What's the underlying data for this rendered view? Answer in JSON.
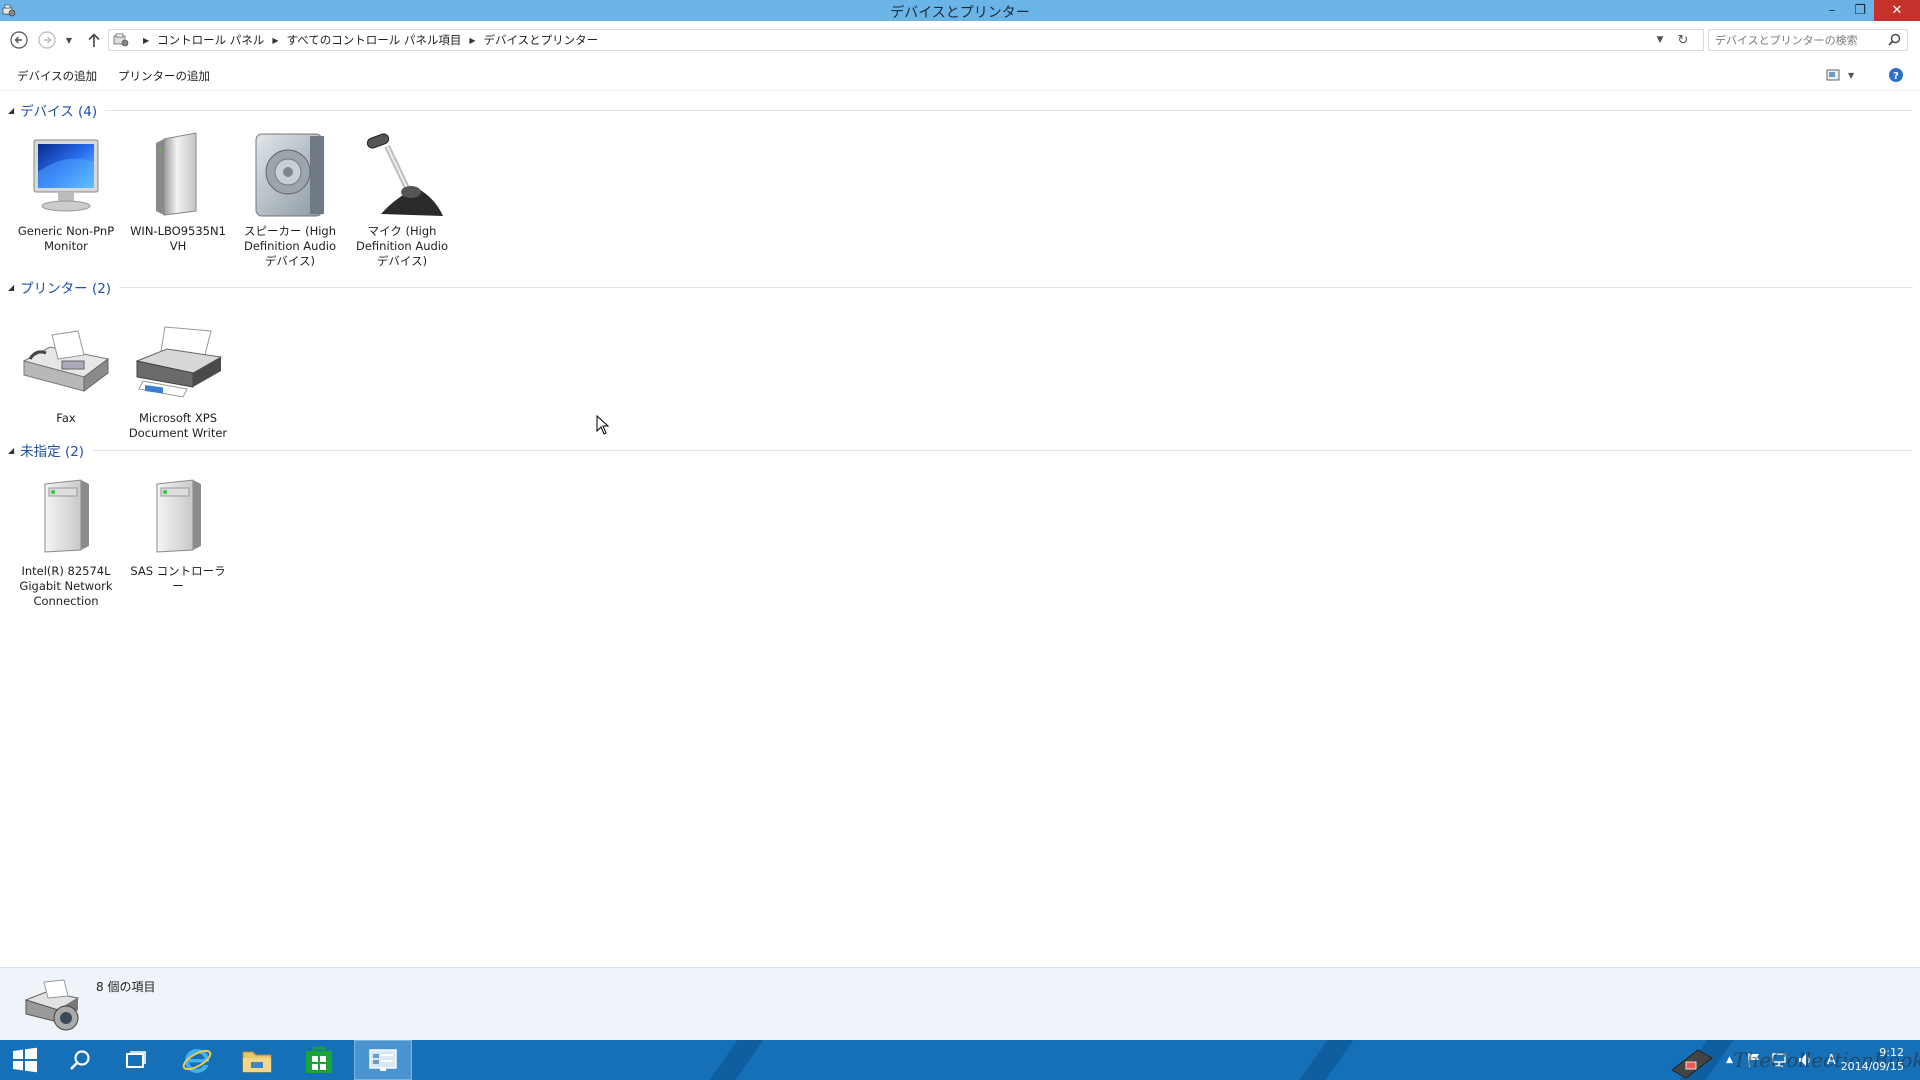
{
  "window": {
    "title": "デバイスとプリンター",
    "minimize": "–",
    "restore": "❐",
    "close": "✕"
  },
  "address": {
    "breadcrumbs": [
      "コントロール パネル",
      "すべてのコントロール パネル項目",
      "デバイスとプリンター"
    ],
    "search_placeholder": "デバイスとプリンターの検索"
  },
  "commands": {
    "add_device": "デバイスの追加",
    "add_printer": "プリンターの追加"
  },
  "groups": {
    "devices": {
      "title": "デバイス (4)",
      "items": [
        {
          "line1": "Generic Non-PnP",
          "line2": "Monitor",
          "line3": "",
          "icon": "monitor-icon"
        },
        {
          "line1": "WIN-LBO9535N1",
          "line2": "VH",
          "line3": "",
          "icon": "computer-tower-icon"
        },
        {
          "line1": "スピーカー (High",
          "line2": "Definition Audio",
          "line3": "デバイス)",
          "icon": "speaker-icon"
        },
        {
          "line1": "マイク (High",
          "line2": "Definition Audio",
          "line3": "デバイス)",
          "icon": "microphone-icon"
        }
      ]
    },
    "printers": {
      "title": "プリンター (2)",
      "items": [
        {
          "line1": "Fax",
          "line2": "",
          "icon": "fax-icon"
        },
        {
          "line1": "Microsoft XPS",
          "line2": "Document Writer",
          "icon": "printer-icon"
        }
      ]
    },
    "unspecified": {
      "title": "未指定 (2)",
      "items": [
        {
          "line1": "Intel(R) 82574L",
          "line2": "Gigabit Network",
          "line3": "Connection",
          "icon": "generic-device-icon"
        },
        {
          "line1": "SAS コントローラー",
          "line2": "",
          "line3": "",
          "icon": "generic-device-icon"
        }
      ]
    }
  },
  "details": {
    "status": "8 個の項目"
  },
  "taskbar": {
    "time": "9:12",
    "date": "2014/09/15",
    "ime": "A",
    "watermark": "TheCollectionBook"
  },
  "colors": {
    "titlebar": "#6ab4e8",
    "taskbar": "#1670b8",
    "group_header": "#1e50a0",
    "close_button": "#c7312b"
  }
}
